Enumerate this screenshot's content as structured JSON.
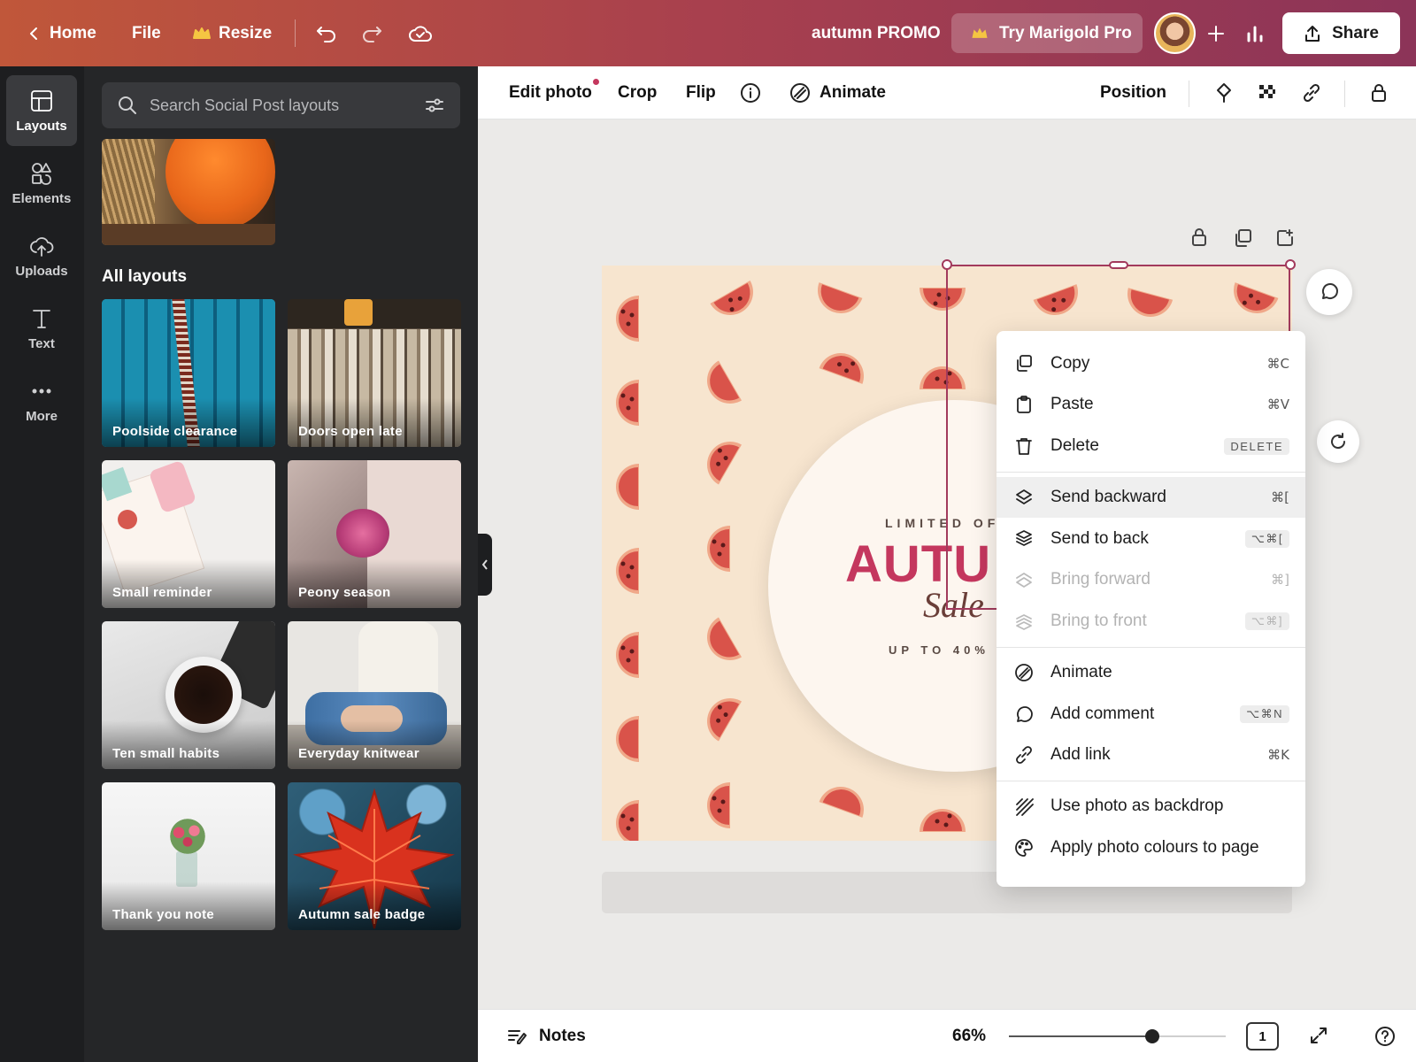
{
  "topbar": {
    "home": "Home",
    "file": "File",
    "resize": "Resize",
    "doc_title": "autumn PROMO",
    "try_pro": "Try Marigold Pro",
    "share": "Share"
  },
  "rail": {
    "items": [
      {
        "label": "Layouts",
        "icon": "layouts-icon",
        "active": true
      },
      {
        "label": "Elements",
        "icon": "elements-icon"
      },
      {
        "label": "Uploads",
        "icon": "upload-cloud-icon"
      },
      {
        "label": "Text",
        "icon": "text-icon"
      },
      {
        "label": "More",
        "icon": "more-dots-icon"
      }
    ]
  },
  "panel": {
    "search_placeholder": "Search Social Post layouts",
    "section_title": "All layouts",
    "layouts": [
      {
        "label": "Poolside clearance"
      },
      {
        "label": "Doors open late"
      },
      {
        "label": "Small reminder"
      },
      {
        "label": "Peony season"
      },
      {
        "label": "Ten small habits"
      },
      {
        "label": "Everyday knitwear"
      },
      {
        "label": "Thank you note"
      },
      {
        "label": "Autumn sale badge"
      }
    ]
  },
  "toolbar": {
    "edit_photo": "Edit photo",
    "crop": "Crop",
    "flip": "Flip",
    "animate": "Animate",
    "position": "Position"
  },
  "canvas": {
    "limited_offer": "LIMITED OFF",
    "headline": "AUTU",
    "sale": "Sale",
    "discount": "UP TO 40% O"
  },
  "context_menu": {
    "items": [
      {
        "label": "Copy",
        "shortcut": "⌘C",
        "icon": "copy-icon"
      },
      {
        "label": "Paste",
        "shortcut": "⌘V",
        "icon": "clipboard-icon"
      },
      {
        "label": "Delete",
        "shortcut": "DELETE",
        "icon": "trash-icon"
      },
      {
        "label": "Send backward",
        "shortcut": "⌘[",
        "icon": "send-backward-icon",
        "highlighted": true
      },
      {
        "label": "Send to back",
        "shortcut": "⌥⌘[",
        "icon": "send-to-back-icon"
      },
      {
        "label": "Bring forward",
        "shortcut": "⌘]",
        "icon": "bring-forward-icon",
        "disabled": true
      },
      {
        "label": "Bring to front",
        "shortcut": "⌥⌘]",
        "icon": "bring-to-front-icon",
        "disabled": true
      },
      {
        "label": "Animate",
        "shortcut": "",
        "icon": "animate-icon"
      },
      {
        "label": "Add comment",
        "shortcut": "⌥⌘N",
        "icon": "comment-icon"
      },
      {
        "label": "Add link",
        "shortcut": "⌘K",
        "icon": "link-icon"
      },
      {
        "label": "Use photo as backdrop",
        "shortcut": "",
        "icon": "backdrop-icon"
      },
      {
        "label": "Apply photo colours to page",
        "shortcut": "",
        "icon": "palette-icon"
      }
    ]
  },
  "bottombar": {
    "notes": "Notes",
    "zoom": "66%",
    "zoom_value": 0.66,
    "page": "1"
  },
  "colors": {
    "accent": "#a23a5c",
    "watermelon": "#d9534a",
    "rind": "#f0a889",
    "artboard_bg": "#f7e5cf"
  }
}
